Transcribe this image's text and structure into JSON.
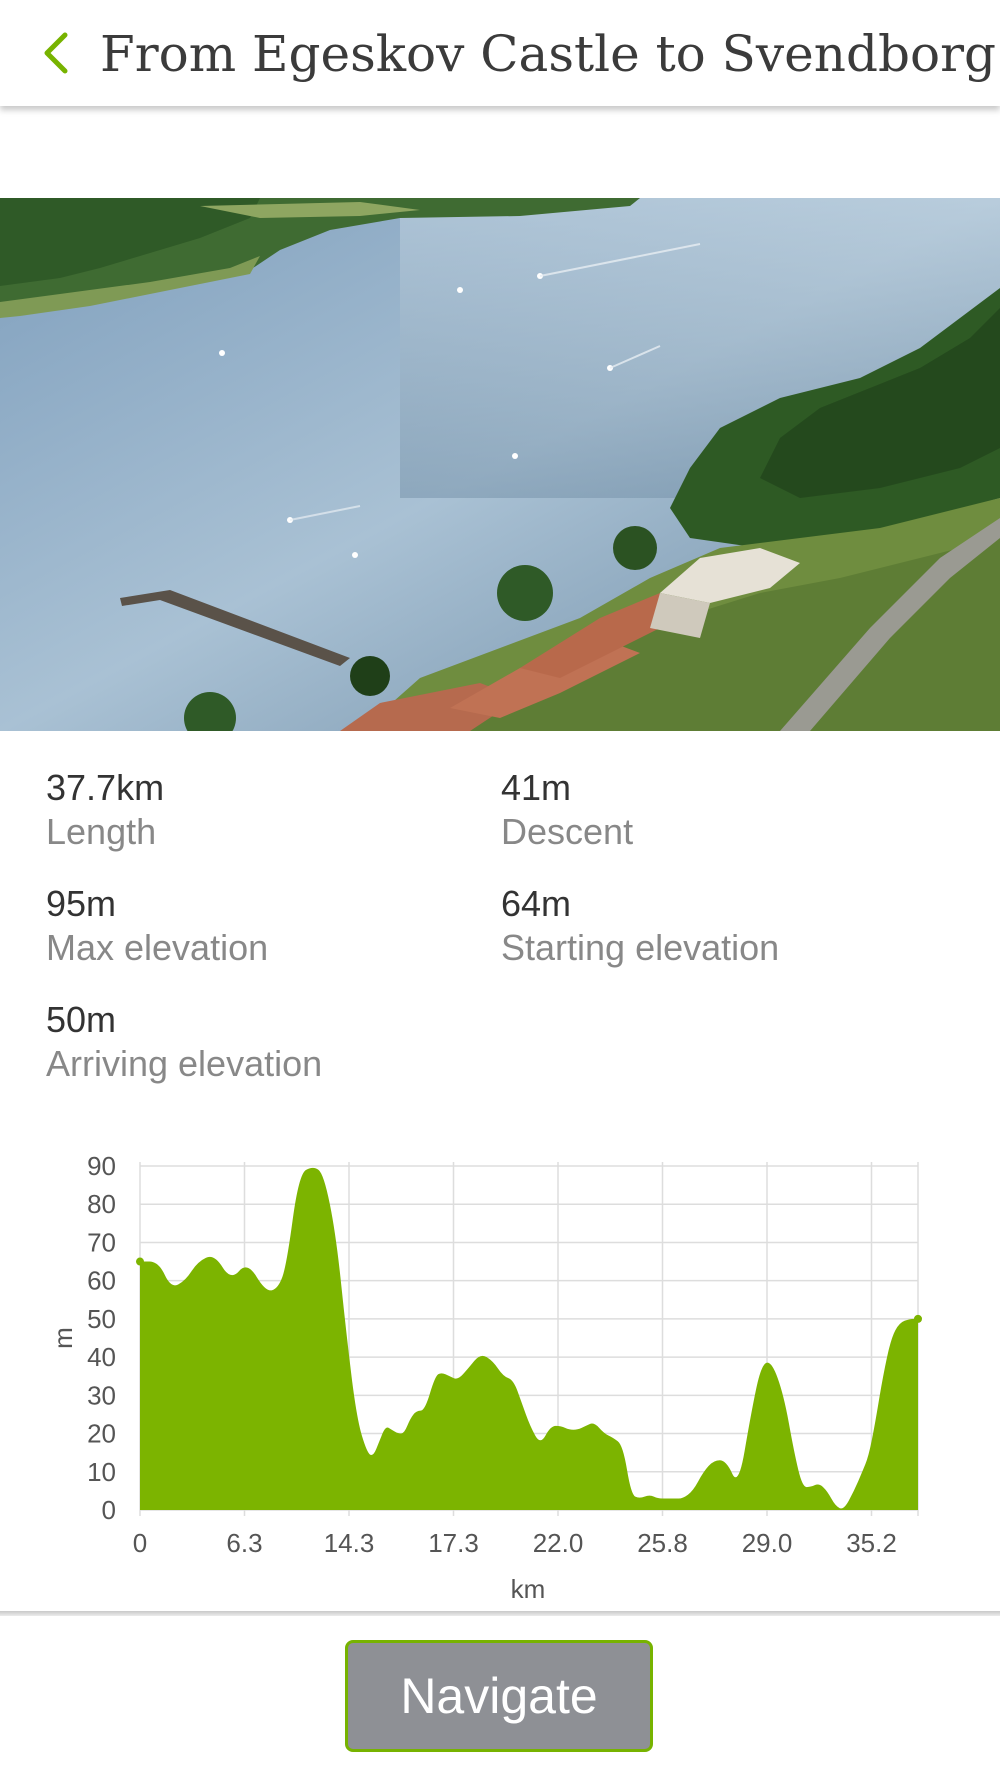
{
  "header": {
    "title": "From Egeskov Castle to Svendborg",
    "back_icon": "chevron-left-icon"
  },
  "colors": {
    "accent": "#77b300",
    "chart_fill": "#7cb400",
    "button_bg": "#8e9095"
  },
  "hero": {
    "description": "Aerial photo of a fjord with a harbor and forested shoreline"
  },
  "stats": [
    {
      "value": "37.7km",
      "label": "Length"
    },
    {
      "value": "41m",
      "label": "Descent"
    },
    {
      "value": "95m",
      "label": "Max elevation"
    },
    {
      "value": "64m",
      "label": "Starting elevation"
    },
    {
      "value": "50m",
      "label": "Arriving elevation"
    }
  ],
  "chart_data": {
    "type": "area",
    "xlabel": "km",
    "ylabel": "m",
    "ylim": [
      0,
      90
    ],
    "yticks": [
      "90",
      "80",
      "70",
      "60",
      "50",
      "40",
      "30",
      "20",
      "10",
      "0"
    ],
    "xtick_labels": [
      "0",
      "6.3",
      "14.3",
      "17.3",
      "22.0",
      "25.8",
      "29.0",
      "35.2"
    ],
    "x": [
      0,
      0.9,
      1.5,
      2.2,
      2.8,
      3.6,
      4.4,
      5.2,
      6.1,
      6.7,
      7.1,
      7.7,
      8.4,
      8.9,
      9.5,
      10.0,
      10.5,
      11.0,
      11.3,
      11.6,
      11.9,
      12.2,
      12.5,
      12.8,
      13.1,
      13.4,
      13.8,
      14.3,
      14.6,
      15.0,
      15.4,
      15.9,
      16.5,
      17.1,
      17.6,
      18.1,
      18.5,
      18.9,
      19.4,
      19.9,
      20.4,
      20.8,
      21.2,
      21.6,
      22.0,
      22.5,
      22.9,
      23.4,
      23.8,
      24.2,
      24.7,
      25.1,
      25.5,
      25.9,
      26.3,
      26.8,
      27.3,
      27.8,
      28.4,
      29.0,
      29.6,
      30.1,
      30.6,
      31.2,
      31.7,
      32.1,
      32.5,
      32.9,
      33.3,
      33.7,
      34.1,
      34.6,
      35.0,
      35.3,
      35.6,
      36.0,
      36.4,
      36.8,
      37.3,
      37.7
    ],
    "values": [
      65,
      65,
      58,
      60,
      65,
      67,
      60,
      65,
      57,
      58,
      64,
      88,
      90,
      88,
      72,
      46,
      24,
      15,
      14,
      18,
      22,
      21,
      20,
      20,
      24,
      26,
      26,
      35,
      36,
      35,
      34,
      37,
      41,
      39,
      35,
      34,
      28,
      22,
      17,
      22,
      22,
      21,
      21,
      22,
      23,
      20,
      19,
      17,
      4,
      3,
      4,
      3,
      3,
      3,
      3,
      5,
      10,
      13,
      13,
      6,
      25,
      38,
      39,
      30,
      15,
      6,
      6,
      7,
      5,
      1,
      0,
      5,
      10,
      14,
      22,
      35,
      45,
      49,
      50,
      50
    ],
    "grid": true,
    "legend": "none"
  },
  "navigate": {
    "label": "Navigate"
  }
}
